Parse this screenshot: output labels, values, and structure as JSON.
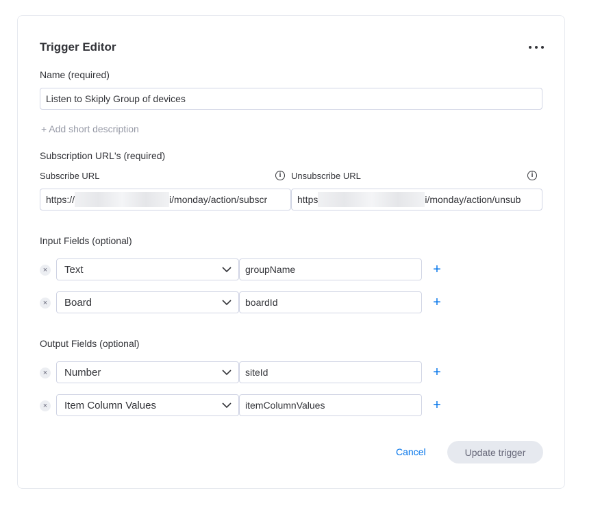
{
  "editor": {
    "title": "Trigger Editor",
    "more_icon": "more-horizontal-icon"
  },
  "name_field": {
    "label": "Name (required)",
    "value": "Listen to Skiply Group of devices"
  },
  "add_description_link": "+ Add short description",
  "subscription": {
    "label": "Subscription URL's (required)",
    "subscribe": {
      "label": "Subscribe URL",
      "info_icon": "info-icon",
      "value_start": "https://",
      "value_end": "i/monday/action/subscr"
    },
    "unsubscribe": {
      "label": "Unsubscribe URL",
      "info_icon": "info-icon",
      "value_start": "https",
      "value_end": "i/monday/action/unsub"
    }
  },
  "input_fields": {
    "label": "Input Fields (optional)",
    "rows": [
      {
        "type": "Text",
        "name": "groupName"
      },
      {
        "type": "Board",
        "name": "boardId"
      }
    ]
  },
  "output_fields": {
    "label": "Output Fields (optional)",
    "rows": [
      {
        "type": "Number",
        "name": "siteId"
      },
      {
        "type": "Item Column Values",
        "name": "itemColumnValues"
      }
    ]
  },
  "glyphs": {
    "remove": "×",
    "add": "+",
    "info": "i"
  },
  "actions": {
    "cancel_label": "Cancel",
    "update_label": "Update trigger"
  },
  "colors": {
    "accent": "#0073ea",
    "disabled_bg": "#e6e9ef",
    "border": "#d0d4e4",
    "text": "#323338"
  }
}
